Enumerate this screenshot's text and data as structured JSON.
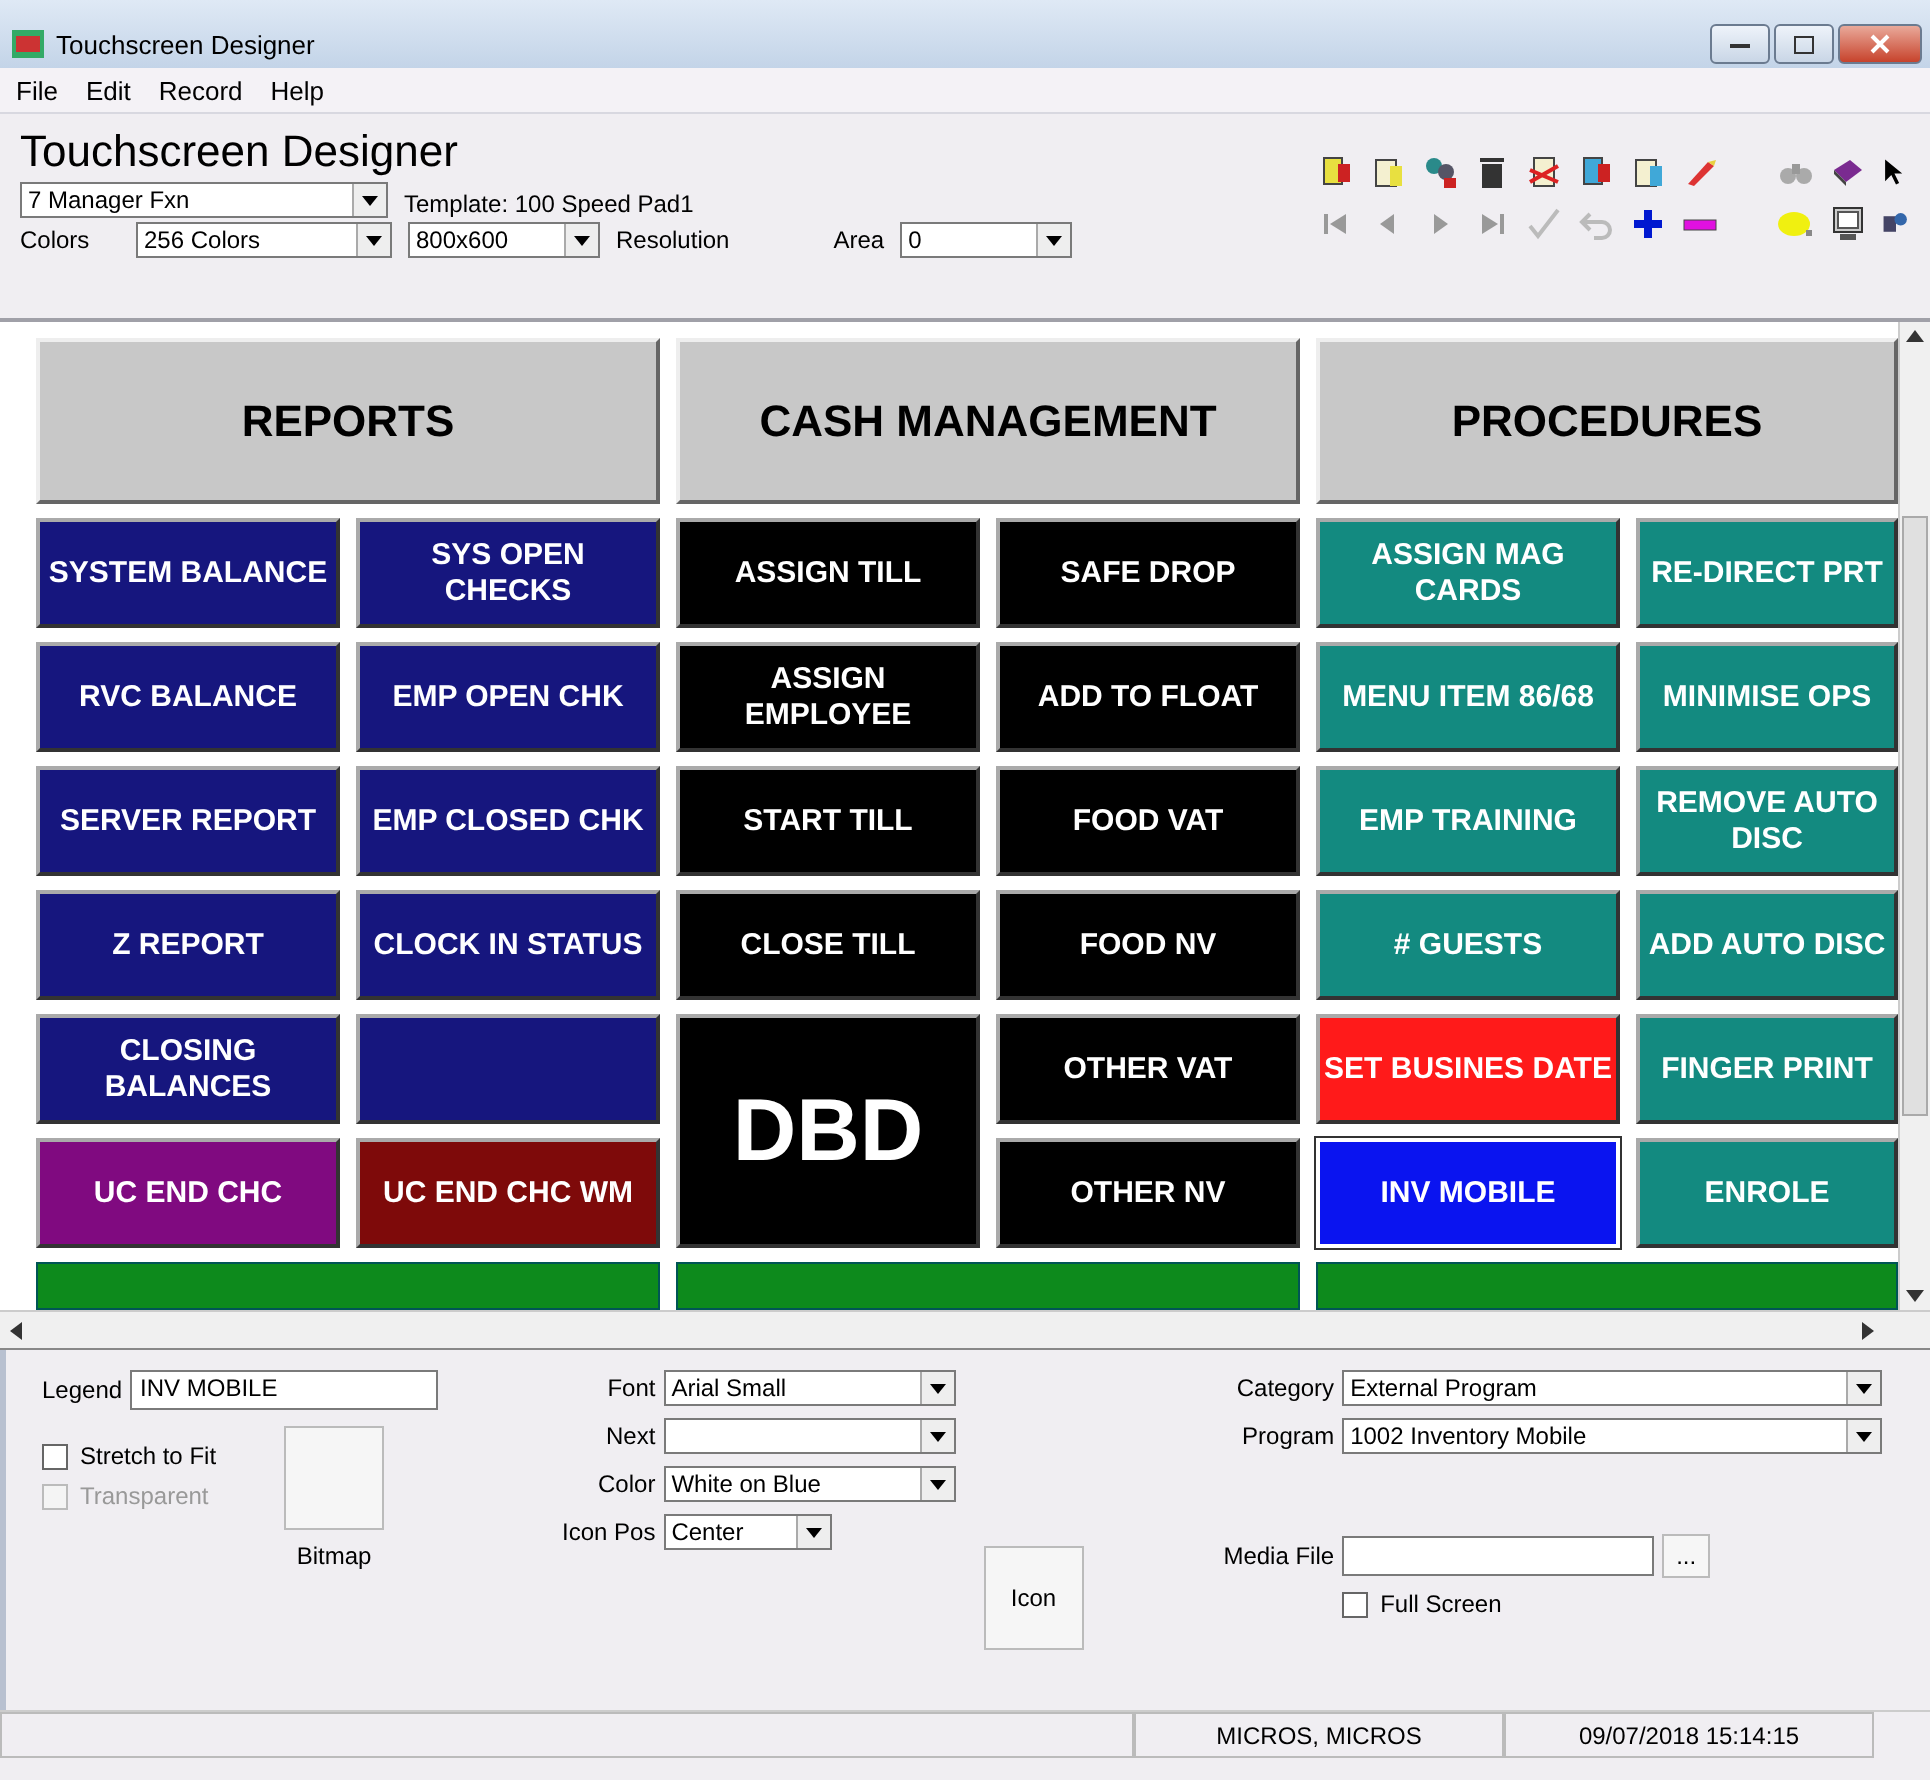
{
  "window": {
    "title": "Touchscreen Designer"
  },
  "menu": [
    "File",
    "Edit",
    "Record",
    "Help"
  ],
  "header": {
    "title": "Touchscreen Designer",
    "screen": "7 Manager Fxn",
    "template": "Template: 100 Speed Pad1",
    "colors_label": "Colors",
    "colors": "256 Colors",
    "resolution_value": "800x600",
    "resolution_label": "Resolution",
    "area_label": "Area",
    "area": "0"
  },
  "sections": [
    {
      "title": "REPORTS",
      "columns": [
        [
          {
            "label": "SYSTEM BALANCE",
            "color": "#16167e",
            "selected": false
          },
          {
            "label": "RVC BALANCE",
            "color": "#16167e",
            "selected": false
          },
          {
            "label": "SERVER REPORT",
            "color": "#16167e",
            "selected": false
          },
          {
            "label": "Z REPORT",
            "color": "#16167e",
            "selected": false
          },
          {
            "label": "CLOSING BALANCES",
            "color": "#16167e",
            "selected": false
          },
          {
            "label": "UC END CHC",
            "color": "#800a80",
            "selected": false
          }
        ],
        [
          {
            "label": "SYS OPEN CHECKS",
            "color": "#16167e",
            "selected": false
          },
          {
            "label": "EMP OPEN CHK",
            "color": "#16167e",
            "selected": false
          },
          {
            "label": "EMP CLOSED CHK",
            "color": "#16167e",
            "selected": false
          },
          {
            "label": "CLOCK IN STATUS",
            "color": "#16167e",
            "selected": false
          },
          {
            "color": "#16167e",
            "selected": false
          },
          {
            "label": "UC END CHC WM",
            "color": "#7e0a0a",
            "selected": false
          }
        ]
      ]
    },
    {
      "title": "CASH MANAGEMENT",
      "columns": [
        [
          {
            "label": "ASSIGN TILL",
            "color": "#000000",
            "selected": false
          },
          {
            "label": "ASSIGN EMPLOYEE",
            "color": "#000000",
            "selected": false
          },
          {
            "label": "START TILL",
            "color": "#000000",
            "selected": false
          },
          {
            "label": "CLOSE TILL",
            "color": "#000000",
            "selected": false
          },
          {
            "label": "DBD",
            "color": "#000000",
            "kind": "large",
            "selected": false
          }
        ],
        [
          {
            "label": "SAFE DROP",
            "color": "#000000",
            "selected": false
          },
          {
            "label": "ADD TO FLOAT",
            "color": "#000000",
            "selected": false
          },
          {
            "label": "FOOD VAT",
            "color": "#000000",
            "selected": false
          },
          {
            "label": "FOOD NV",
            "color": "#000000",
            "selected": false
          },
          {
            "label": "OTHER VAT",
            "color": "#000000",
            "selected": false
          },
          {
            "label": "OTHER NV",
            "color": "#000000",
            "selected": false
          }
        ]
      ]
    },
    {
      "title": "PROCEDURES",
      "columns": [
        [
          {
            "label": "ASSIGN MAG CARDS",
            "color": "#138a80",
            "selected": false
          },
          {
            "label": "MENU ITEM 86/68",
            "color": "#138a80",
            "selected": false
          },
          {
            "label": "EMP TRAINING",
            "color": "#138a80",
            "selected": false
          },
          {
            "label": "# GUESTS",
            "color": "#138a80",
            "selected": false
          },
          {
            "label": "SET BUSINES DATE",
            "color": "#ff1a1a",
            "selected": false
          },
          {
            "label": "INV MOBILE",
            "color": "#0a14f0",
            "selected": true
          }
        ],
        [
          {
            "label": "RE-DIRECT PRT",
            "color": "#138a80",
            "selected": false
          },
          {
            "label": "MINIMISE OPS",
            "color": "#138a80",
            "selected": false
          },
          {
            "label": "REMOVE AUTO DISC",
            "color": "#138a80",
            "selected": false
          },
          {
            "label": "ADD AUTO DISC",
            "color": "#138a80",
            "selected": false
          },
          {
            "label": "FINGER PRINT",
            "color": "#138a80",
            "selected": false
          },
          {
            "label": "ENROLE",
            "color": "#138a80",
            "selected": false
          }
        ]
      ]
    }
  ],
  "properties": {
    "legend_label": "Legend",
    "legend": "INV MOBILE",
    "checkboxes": [
      {
        "label": "Stretch to Fit",
        "checked": false,
        "disabled": false
      },
      {
        "label": "Transparent",
        "checked": false,
        "disabled": true
      }
    ],
    "bitmap_label": "Bitmap",
    "dropdowns": [
      {
        "label": "Font",
        "value": "Arial Small"
      },
      {
        "label": "Next"
      },
      {
        "label": "Color",
        "value": "White on Blue"
      },
      {
        "label": "Icon Pos",
        "value": "Center"
      }
    ],
    "icon_button": "Icon",
    "right_dropdowns": [
      {
        "label": "Category",
        "value": "External Program"
      },
      {
        "label": "Program",
        "value": "1002  Inventory Mobile"
      }
    ],
    "media_label": "Media File",
    "browse": "...",
    "full_screen": {
      "label": "Full Screen",
      "checked": false
    }
  },
  "status_bar": [
    "MICROS, MICROS",
    "09/07/2018 15:14:15"
  ]
}
